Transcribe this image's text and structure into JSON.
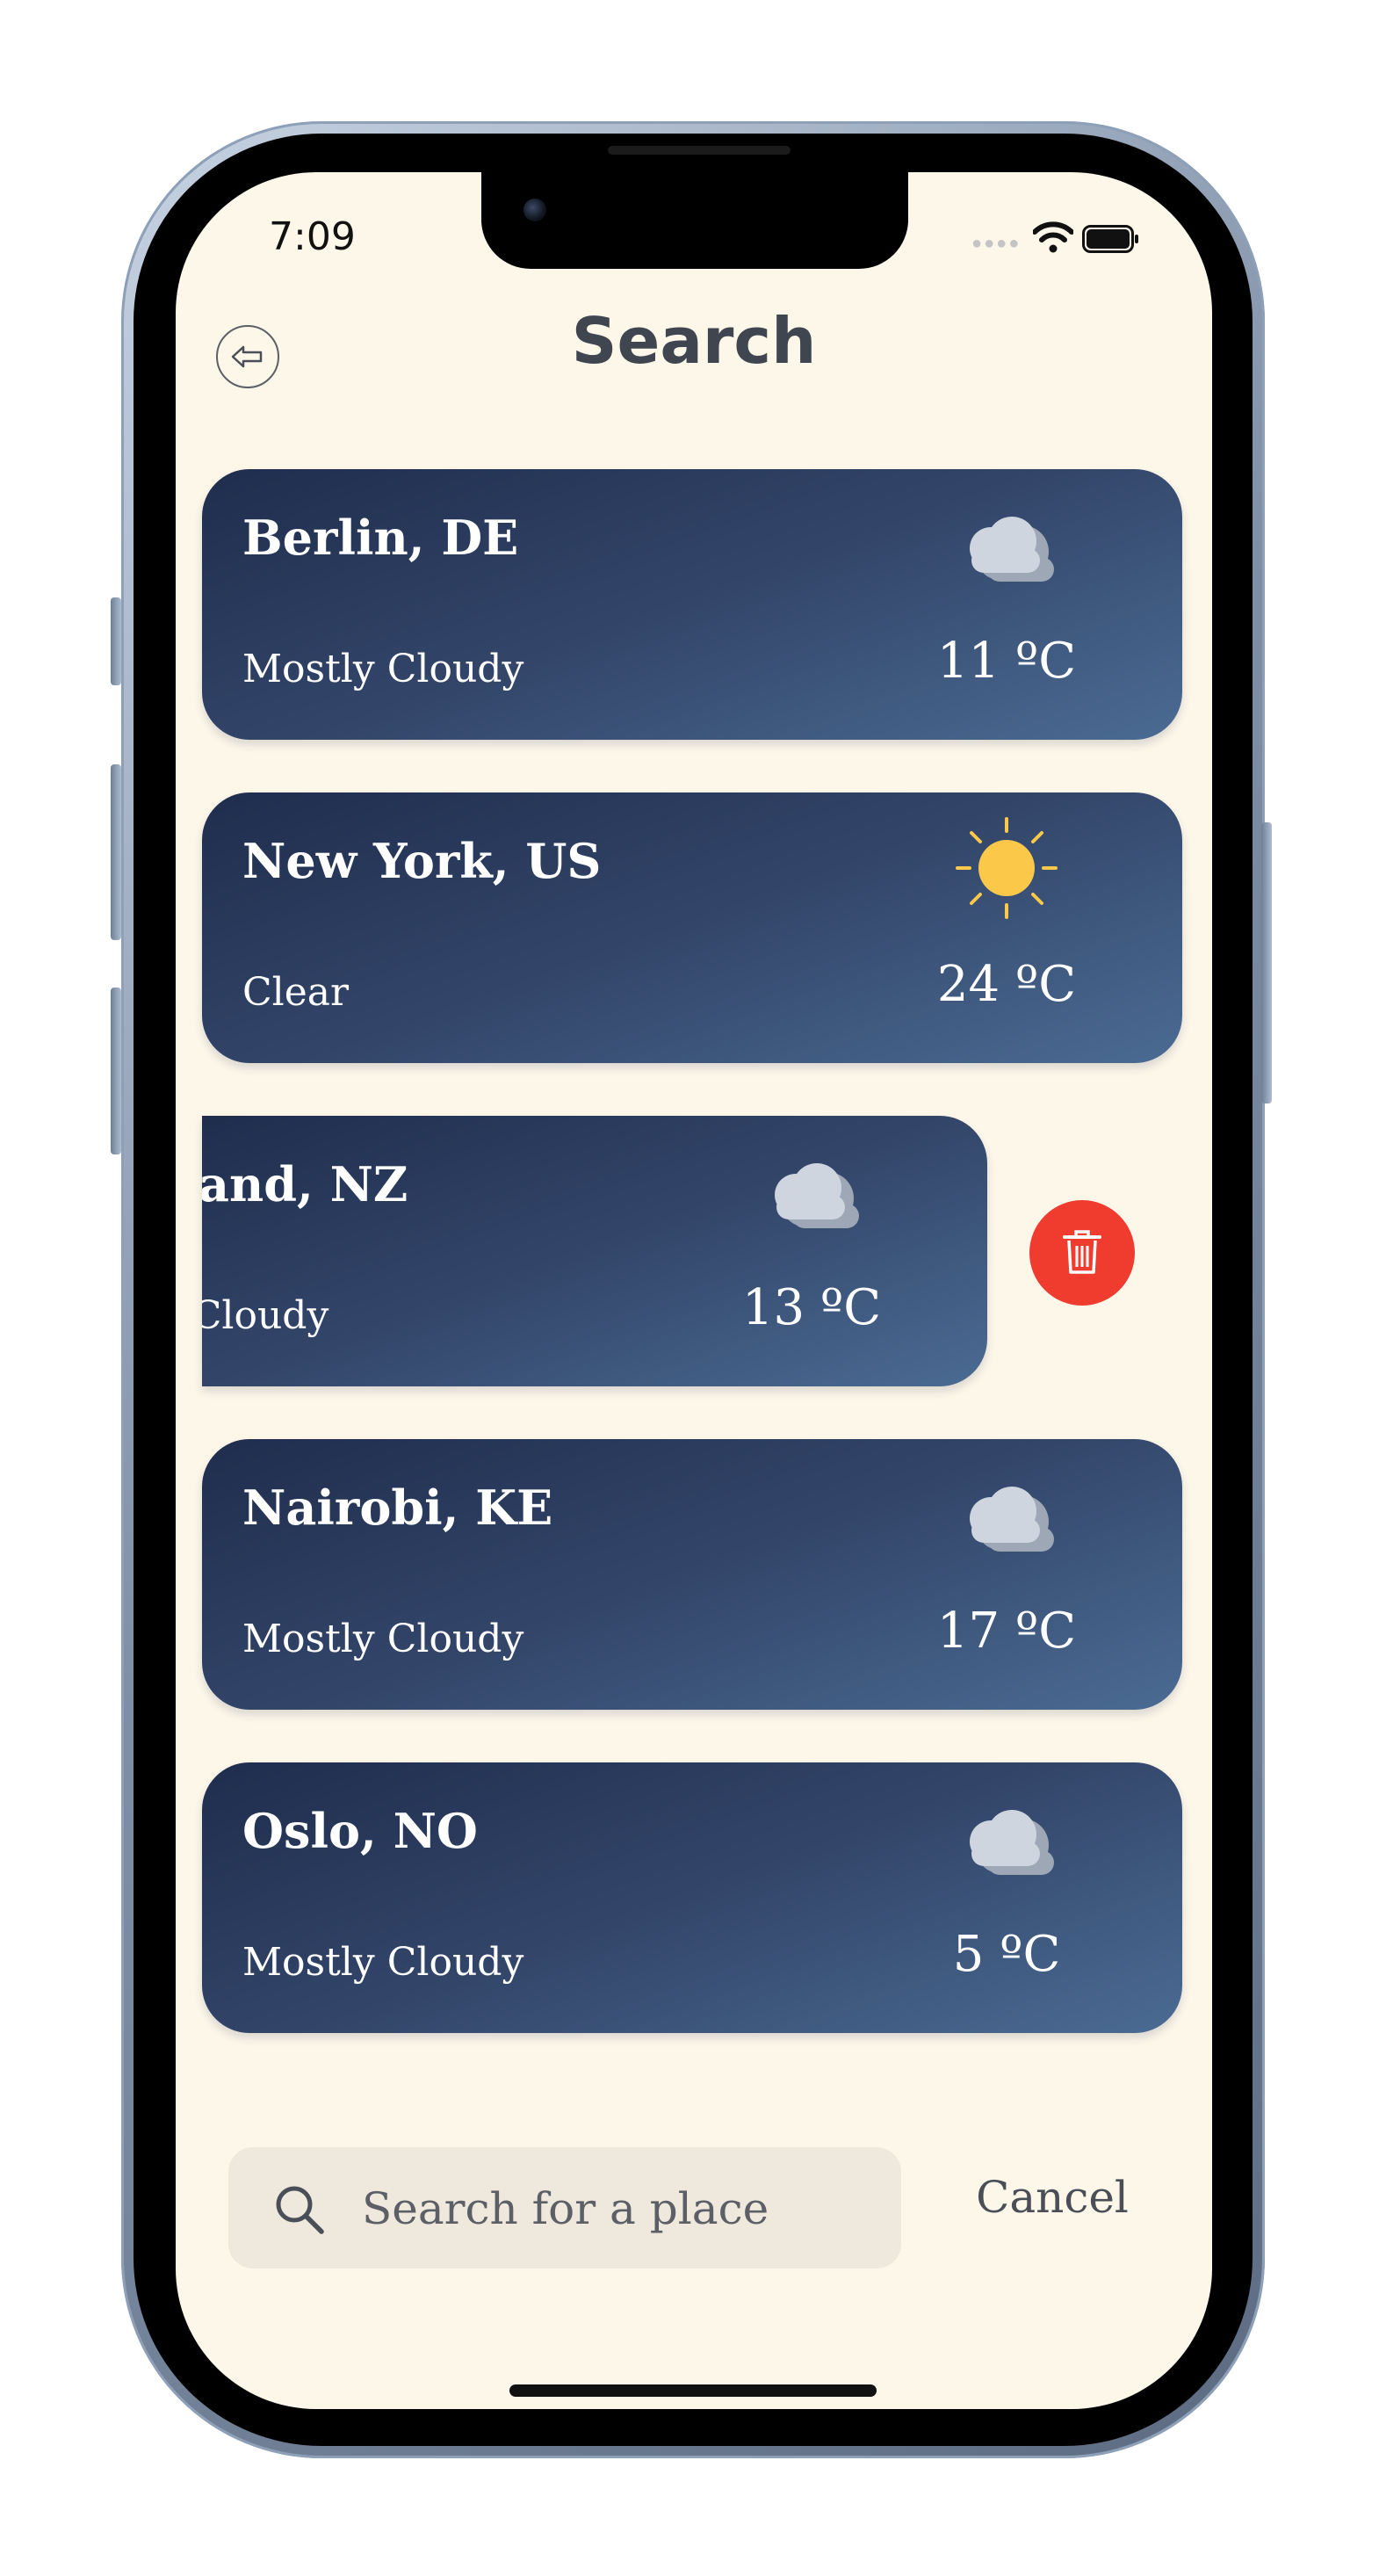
{
  "status_bar": {
    "time": "7:09"
  },
  "header": {
    "title": "Search"
  },
  "cards": [
    {
      "city": "Berlin, DE",
      "condition": "Mostly Cloudy",
      "temp": "11 ºC",
      "icon": "cloud-icon"
    },
    {
      "city": "New York, US",
      "condition": "Clear",
      "temp": "24 ºC",
      "icon": "sun-icon"
    },
    {
      "city": "Auckland, NZ",
      "condition": "Mostly Cloudy",
      "temp": "13 ºC",
      "icon": "cloud-icon",
      "swiped": true
    },
    {
      "city": "Nairobi, KE",
      "condition": "Mostly Cloudy",
      "temp": "17 ºC",
      "icon": "cloud-icon"
    },
    {
      "city": "Oslo, NO",
      "condition": "Mostly Cloudy",
      "temp": "5 ºC",
      "icon": "cloud-icon"
    }
  ],
  "delete_action": {
    "icon": "trash-icon"
  },
  "search": {
    "placeholder": "Search for a place",
    "value": ""
  },
  "cancel_label": "Cancel",
  "colors": {
    "background": "#fdf7ea",
    "card_gradient_start": "#1f2d4d",
    "card_gradient_end": "#4b6b93",
    "delete_red": "#f03b2f",
    "sun_yellow": "#fbc84a"
  }
}
